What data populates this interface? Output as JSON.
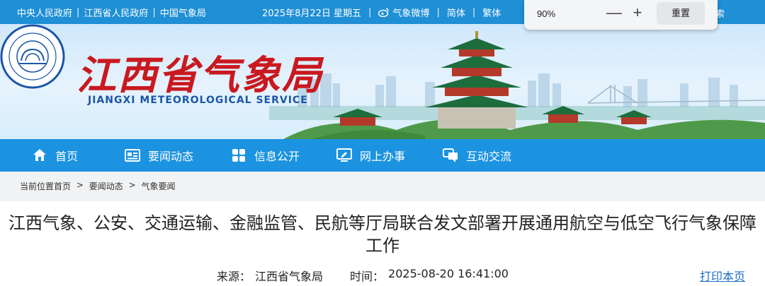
{
  "topbar": {
    "links": [
      "中央人民政府",
      "江西省人民政府",
      "中国气象局"
    ],
    "separator": "|",
    "date": "2025年8月22日 星期五",
    "weibo": "气象微博",
    "simplified": "简体",
    "traditional": "繁体",
    "tail_text": "索"
  },
  "zoom": {
    "value": "90%",
    "minus": "—",
    "plus": "+",
    "reset": "重置"
  },
  "banner": {
    "title": "江西省气象局",
    "subtitle": "JIANGXI METEOROLOGICAL SERVICE",
    "logo_top_text": "江西气象",
    "logo_bottom_text": "JIANGXI METEOROLOGY"
  },
  "nav": {
    "items": [
      {
        "label": "首页",
        "icon": "home-icon"
      },
      {
        "label": "要闻动态",
        "icon": "news-icon"
      },
      {
        "label": "信息公开",
        "icon": "grid-icon"
      },
      {
        "label": "网上办事",
        "icon": "monitor-icon"
      },
      {
        "label": "互动交流",
        "icon": "chat-icon"
      }
    ]
  },
  "breadcrumb": {
    "items": [
      "当前位置首页",
      "要闻动态",
      "气象要闻"
    ],
    "separator": ">"
  },
  "article": {
    "title_line1": "江西气象、公安、交通运输、金融监管、民航等厅局联合发文部署开展通用航空与低空飞行气象保障",
    "title_line2": "工作",
    "source_label": "来源：",
    "source": "江西省气象局",
    "time_label": "时间：",
    "time": "2025-08-20 16:41:00",
    "print": "打印本页"
  },
  "colors": {
    "topbar": "#1f8fd6",
    "nav": "#1b93e0",
    "title_red": "#c9191f",
    "link_blue": "#1a6fc4"
  }
}
